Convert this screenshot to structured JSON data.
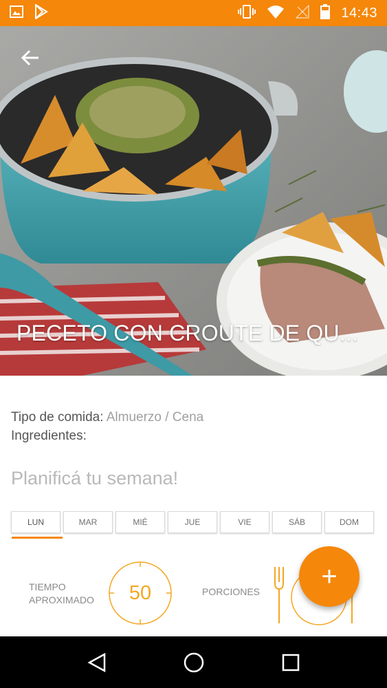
{
  "status_bar": {
    "time": "14:43",
    "icons": [
      "image-icon",
      "play-store-icon",
      "vibrate-icon",
      "wifi-icon",
      "no-signal-icon",
      "battery-icon"
    ],
    "background": "#F5870A"
  },
  "recipe": {
    "title": "PECETO CON CROUTE DE QU...",
    "meal_type_label": "Tipo de comida:",
    "meal_type_value": "Almuerzo / Cena",
    "ingredients_label": "Ingredientes:"
  },
  "planner": {
    "title": "Planificá tu semana!",
    "days": [
      "LUN",
      "MAR",
      "MIÉ",
      "JUE",
      "VIE",
      "SÁB",
      "DOM"
    ],
    "selected_day": "LUN"
  },
  "stats": {
    "time_label_line1": "TIEMPO",
    "time_label_line2": "APROXIMADO",
    "time_value": "50",
    "portions_label": "PORCIONES"
  },
  "fab": {
    "label": "+"
  },
  "nav": {
    "icons": [
      "back-triangle-icon",
      "home-circle-icon",
      "recents-square-icon"
    ]
  },
  "colors": {
    "accent": "#F5870A",
    "timer": "#F5A623"
  }
}
